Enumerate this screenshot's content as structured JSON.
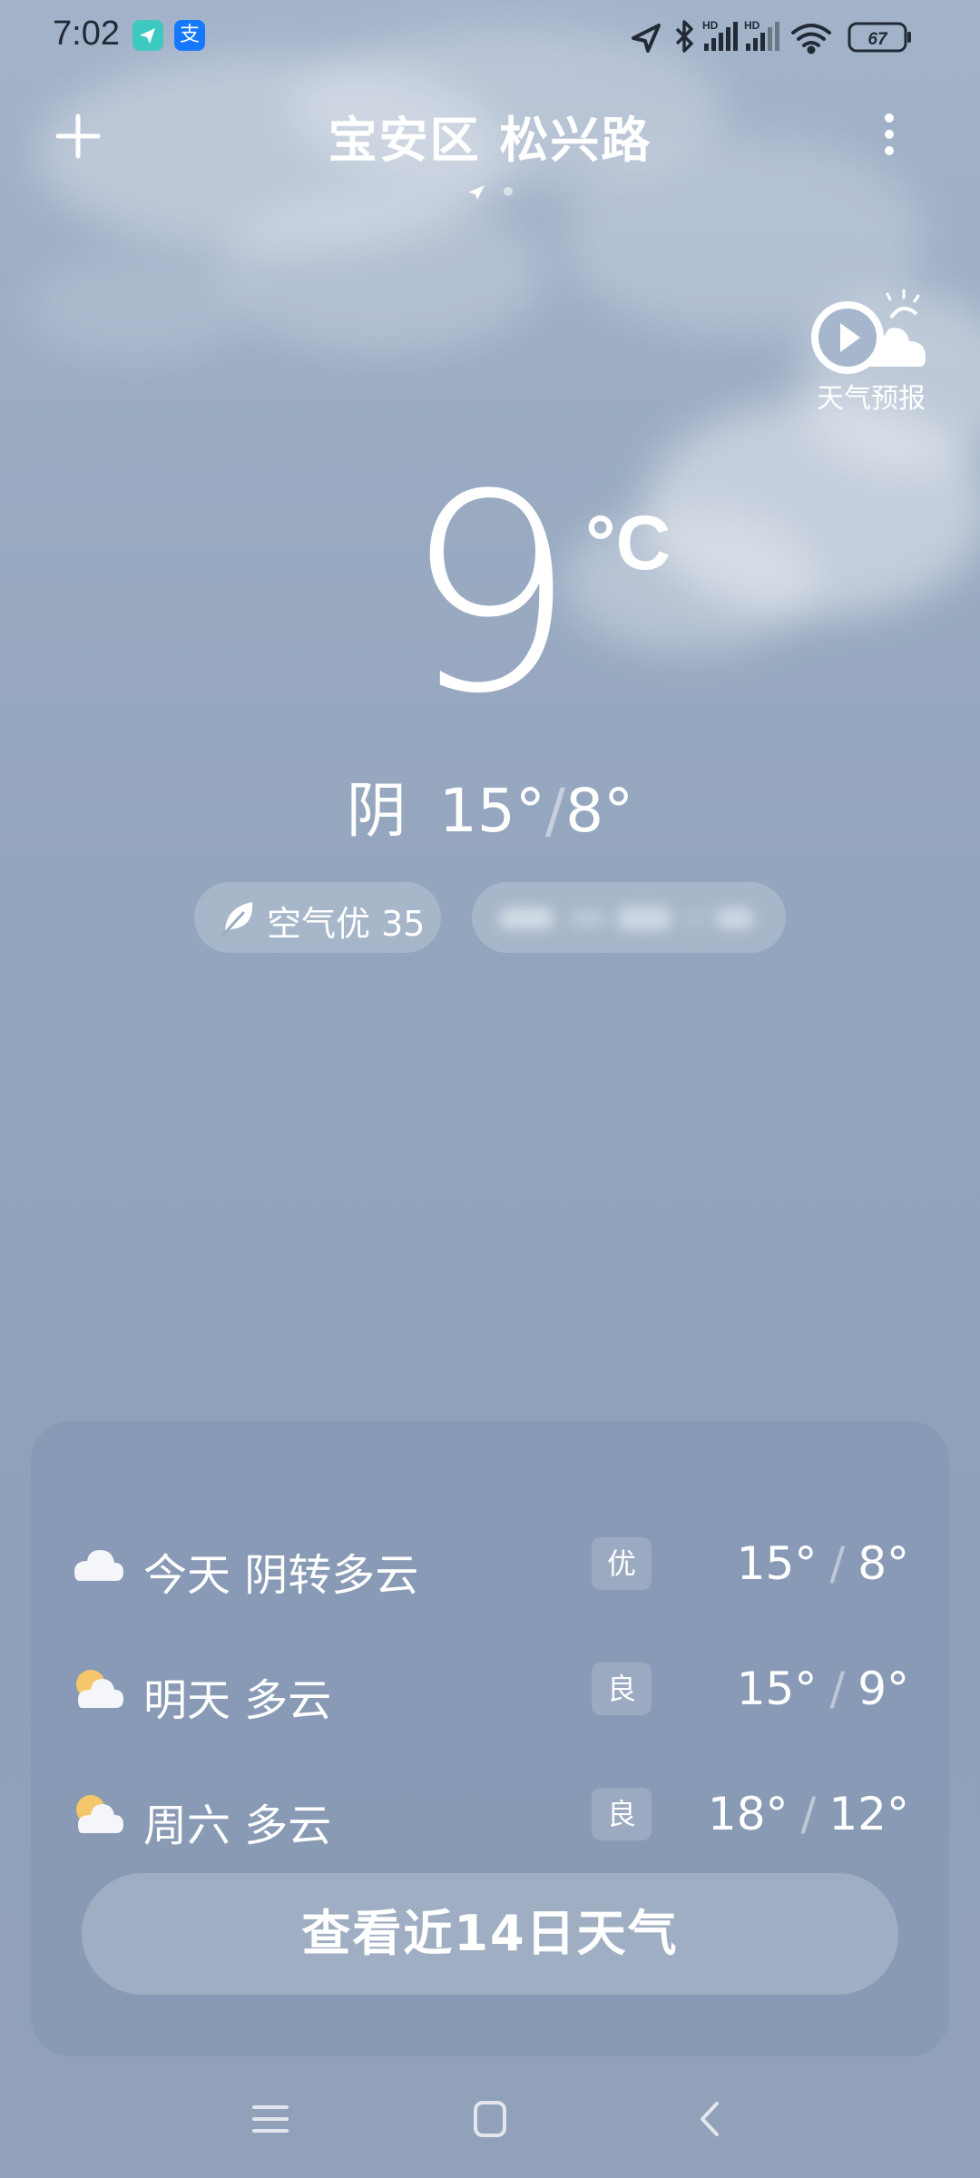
{
  "status_bar": {
    "time": "7:02",
    "app_icon_1": "send-icon",
    "app_icon_2": "支",
    "battery": "67",
    "network_1": "HD",
    "network_2": "HD"
  },
  "header": {
    "location": "宝安区 松兴路",
    "add_icon": "plus-icon",
    "more_icon": "more-vertical-icon"
  },
  "forecast_video": {
    "label": "天气预报"
  },
  "current": {
    "temperature": "9",
    "unit": "°C",
    "condition": "阴",
    "high": "15°",
    "separator": "/",
    "low": "8°"
  },
  "chips": {
    "air_quality": "空气优 35"
  },
  "forecast": {
    "days": [
      {
        "label": "今天  阴转多云",
        "aqi": "优",
        "high": "15°",
        "low": "8°",
        "icon": "cloudy-icon"
      },
      {
        "label": "明天  多云",
        "aqi": "良",
        "high": "15°",
        "low": "9°",
        "icon": "partly-cloudy-icon"
      },
      {
        "label": "周六  多云",
        "aqi": "良",
        "high": "18°",
        "low": "12°",
        "icon": "partly-cloudy-icon"
      }
    ],
    "button_label": "查看近14日天气"
  },
  "colors": {
    "background_top": "#a3b3c9",
    "background_bottom": "#90a1b9",
    "text": "#ffffff",
    "status_text": "#222a36"
  }
}
